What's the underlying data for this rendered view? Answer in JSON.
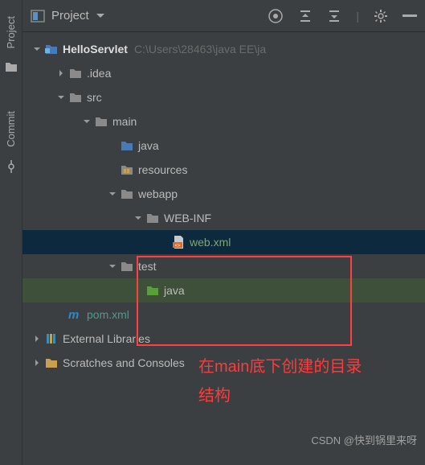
{
  "gutter": {
    "project_label": "Project",
    "commit_label": "Commit"
  },
  "toolbar": {
    "selector_label": "Project"
  },
  "tree": {
    "root_name": "HelloServlet",
    "root_path": "C:\\Users\\28463\\java EE\\ja",
    "idea": ".idea",
    "src": "src",
    "main": "main",
    "java": "java",
    "resources": "resources",
    "webapp": "webapp",
    "webinf": "WEB-INF",
    "webxml": "web.xml",
    "test": "test",
    "test_java": "java",
    "pom": "pom.xml",
    "external_libs": "External Libraries",
    "scratches": "Scratches and Consoles"
  },
  "annotation": {
    "line1": "在main底下创建的目录",
    "line2": "结构"
  },
  "watermark": "CSDN @快到锅里来呀"
}
